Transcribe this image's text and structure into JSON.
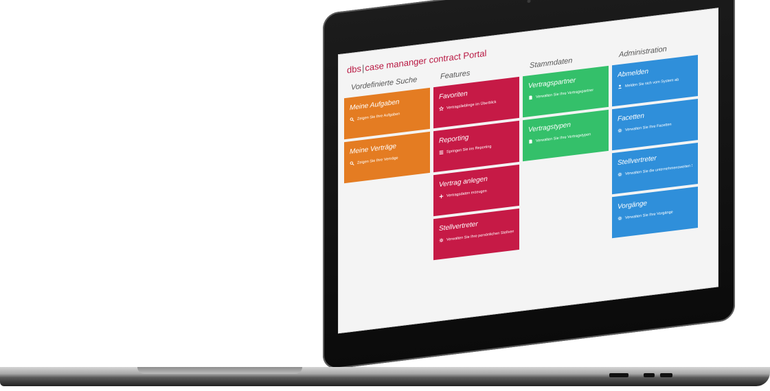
{
  "app": {
    "brand_prefix": "dbs",
    "brand_separator": "|",
    "brand_title": "case mananger contract Portal"
  },
  "columns": [
    {
      "title": "Vordefinierte Suche",
      "tiles": [
        {
          "title": "Meine Aufgaben",
          "subtitle": "Zeigen Sie Ihre Aufgaben",
          "icon": "search-icon",
          "color": "#e47c22"
        },
        {
          "title": "Meine Verträge",
          "subtitle": "Zeigen Sie Ihre Verträge",
          "icon": "search-icon",
          "color": "#e47c22"
        }
      ]
    },
    {
      "title": "Features",
      "tiles": [
        {
          "title": "Favoriten",
          "subtitle": "Vertragslieblinge im Überblick",
          "icon": "star-icon",
          "color": "#c61a46"
        },
        {
          "title": "Reporting",
          "subtitle": "Springen Sie ins Reporting",
          "icon": "list-icon",
          "color": "#c61a46"
        },
        {
          "title": "Vertrag anlegen",
          "subtitle": "Vertragsdaten erzeugen",
          "icon": "plus-icon",
          "color": "#c61a46"
        },
        {
          "title": "Stellvertreter",
          "subtitle": "Verwalten Sie Ihre persönlichen Stellvertreter",
          "icon": "gear-icon",
          "color": "#c61a46"
        }
      ]
    },
    {
      "title": "Stammdaten",
      "tiles": [
        {
          "title": "Vertragspartner",
          "subtitle": "Verwalten Sie Ihre Vertragspartner",
          "icon": "document-icon",
          "color": "#34c06a"
        },
        {
          "title": "Vertragstypen",
          "subtitle": "Verwalten Sie Ihre Vertragstypen",
          "icon": "document-icon",
          "color": "#34c06a"
        }
      ]
    },
    {
      "title": "Administration",
      "tiles": [
        {
          "title": "Abmelden",
          "subtitle": "Melden Sie sich vom System ab",
          "icon": "user-icon",
          "color": "#2f8fda"
        },
        {
          "title": "Facetten",
          "subtitle": "Verwalten Sie Ihre Facetten",
          "icon": "gear-icon",
          "color": "#2f8fda"
        },
        {
          "title": "Stellvertreter",
          "subtitle": "Verwalten Sie die unternehmensweiten Stellvertr...",
          "icon": "gear-icon",
          "color": "#2f8fda"
        },
        {
          "title": "Vorgänge",
          "subtitle": "Verwalten Sie Ihre Vorgänge",
          "icon": "gear-icon",
          "color": "#2f8fda"
        }
      ]
    }
  ]
}
